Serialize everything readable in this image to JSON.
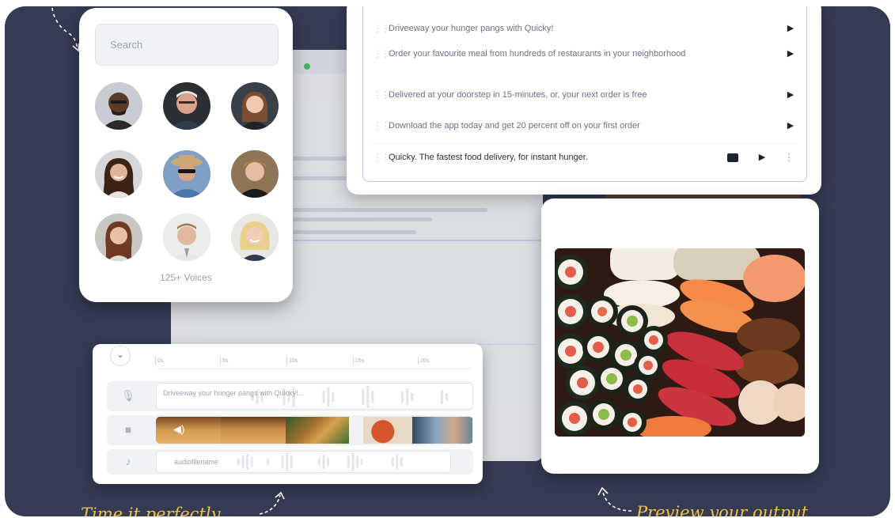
{
  "voice_picker": {
    "search_placeholder": "Search",
    "voices_count_label": "125+ Voices",
    "avatars": [
      {
        "name": "voice-avatar-1"
      },
      {
        "name": "voice-avatar-2"
      },
      {
        "name": "voice-avatar-3"
      },
      {
        "name": "voice-avatar-4"
      },
      {
        "name": "voice-avatar-5"
      },
      {
        "name": "voice-avatar-6"
      },
      {
        "name": "voice-avatar-7"
      },
      {
        "name": "voice-avatar-8"
      },
      {
        "name": "voice-avatar-9"
      }
    ]
  },
  "script": {
    "lines": [
      {
        "text": "Driveeway your hunger pangs with Quicky!",
        "icon": "play-icon"
      },
      {
        "text": "Order your favourite meal from hundreds of restaurants in your neighborhood",
        "icon": "play-icon"
      },
      {
        "text": "Delivered at your doorstep in 15-minutes, or, your next order is free",
        "icon": "play-icon"
      },
      {
        "text": "Download the app today and get 20 percent off on your first order",
        "icon": "play-icon"
      }
    ],
    "active_line": {
      "text": "Quicky. The fastest food delivery, for instant hunger.",
      "icons": [
        "comment-icon",
        "play-icon",
        "more-icon"
      ]
    }
  },
  "timeline": {
    "ruler_ticks": [
      "0s",
      "5s",
      "10s",
      "15s",
      "20s"
    ],
    "voice_track_text": "Driveeway your hunger pangs with Quicky!...",
    "audio_track_text": "audiofilename",
    "track_icons": [
      "microphone-icon",
      "video-camera-icon",
      "music-note-icon"
    ]
  },
  "captions": {
    "left": "Time it perfectly",
    "right": "Preview your output"
  },
  "colors": {
    "background": "#343b52",
    "caption": "#f2c34a",
    "active_border": "#b9c6ee"
  }
}
